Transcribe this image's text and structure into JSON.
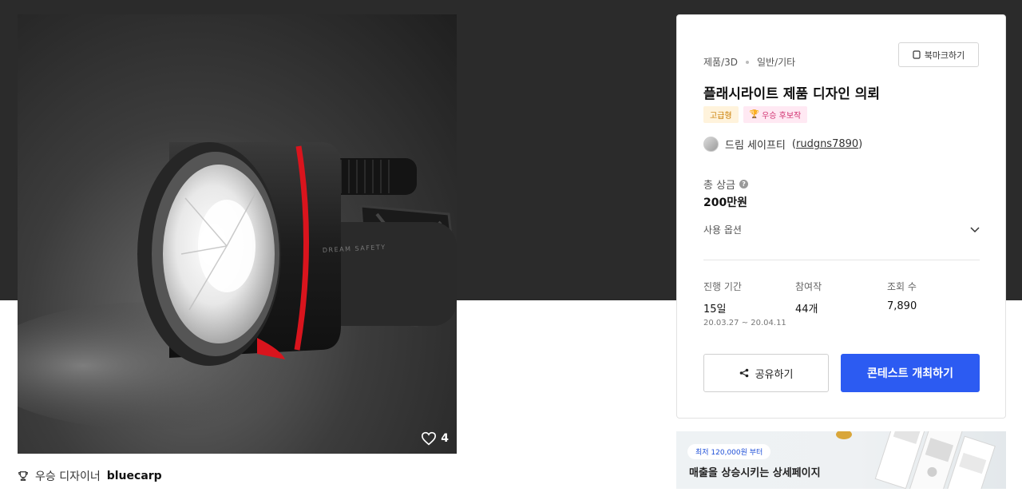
{
  "product": {
    "likes": "4",
    "winner_label": "우승 디자이너",
    "winner_name": "bluecarp",
    "image_brand_text": "DREAM SAFETY"
  },
  "card": {
    "category": "제품/3D",
    "subcategory": "일반/기타",
    "bookmark_label": "북마크하기",
    "title": "플래시라이트 제품 디자인 의뢰",
    "badges": [
      "고급형",
      "우승 후보작"
    ],
    "client_name": "드림 세이프티",
    "client_handle": "rudgns7890",
    "prize_label": "총 상금",
    "prize_value": "200만원",
    "options_label": "사용 옵션",
    "stats": [
      {
        "label": "진행 기간",
        "value": "15일",
        "sub": "20.03.27 ~ 20.04.11"
      },
      {
        "label": "참여작",
        "value": "44개",
        "sub": ""
      },
      {
        "label": "조회 수",
        "value": "7,890",
        "sub": ""
      }
    ],
    "share_label": "공유하기",
    "host_label": "콘테스트 개최하기"
  },
  "ad": {
    "pill": "최저 120,000원 부터",
    "text": "매출을 상승시키는 상세페이지"
  },
  "colors": {
    "primary": "#2c5bf2",
    "dark_band": "#2b2b2b",
    "accent_red": "#d9141d"
  }
}
